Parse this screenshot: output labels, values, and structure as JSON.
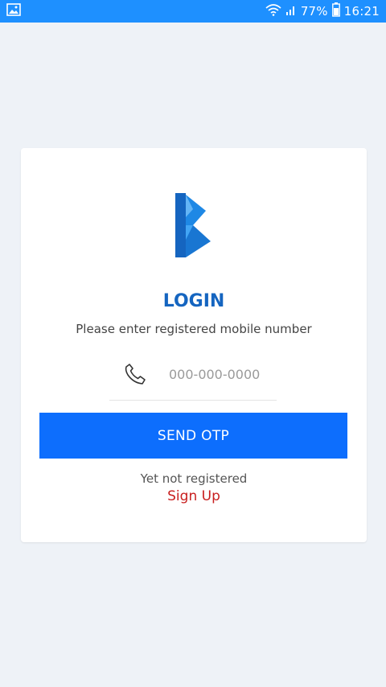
{
  "status_bar": {
    "battery": "77%",
    "time": "16:21",
    "icons": [
      "gallery-icon",
      "wifi-icon",
      "signal-icon",
      "battery-icon"
    ]
  },
  "login": {
    "title": "LOGIN",
    "subtitle": "Please enter registered mobile number",
    "phone_placeholder": "000-000-0000",
    "phone_value": "",
    "send_otp_label": "SEND OTP",
    "not_registered_text": "Yet not registered",
    "signup_label": "Sign Up"
  },
  "colors": {
    "status_bar": "#1e90ff",
    "title": "#1565c0",
    "button": "#0d6efd",
    "signup": "#c81e1e",
    "background": "#eef2f7"
  }
}
